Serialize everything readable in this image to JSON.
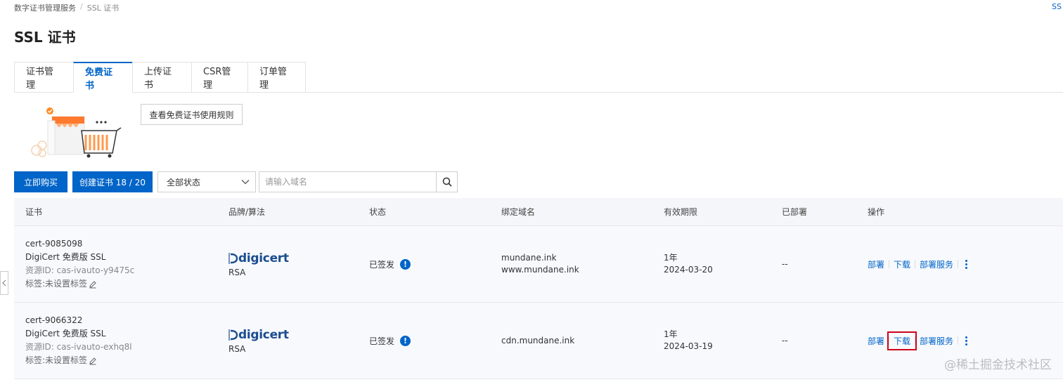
{
  "breadcrumb": {
    "root": "数字证书管理服务",
    "separator": "/",
    "current": "SSL 证书"
  },
  "corner_link": "SS",
  "page_title": "SSL 证书",
  "tabs": [
    {
      "label": "证书管理",
      "active": false
    },
    {
      "label": "免费证书",
      "active": true
    },
    {
      "label": "上传证书",
      "active": false
    },
    {
      "label": "CSR管理",
      "active": false
    },
    {
      "label": "订单管理",
      "active": false
    }
  ],
  "rules_button": "查看免费证书使用规则",
  "toolbar": {
    "buy_label": "立即购买",
    "create_label": "创建证书 18 / 20",
    "status_select": "全部状态",
    "search_placeholder": "请输入域名"
  },
  "table": {
    "headers": [
      "证书",
      "品牌/算法",
      "状态",
      "绑定域名",
      "有效期限",
      "已部署",
      "操作"
    ],
    "rows": [
      {
        "cert_id": "cert-9085098",
        "cert_type": "DigiCert 免费版 SSL",
        "resource_id": "资源ID: cas-ivauto-y9475c",
        "tag": "标签:未设置标签",
        "brand": "digicert",
        "algorithm": "RSA",
        "status": "已签发",
        "domain_1": "mundane.ink",
        "domain_2": "www.mundane.ink",
        "validity_period": "1年",
        "validity_date": "2024-03-20",
        "deployed": "--",
        "op_deploy": "部署",
        "op_download": "下载",
        "op_service": "部署服务"
      },
      {
        "cert_id": "cert-9066322",
        "cert_type": "DigiCert 免费版 SSL",
        "resource_id": "资源ID: cas-ivauto-exhq8l",
        "tag": "标签:未设置标签",
        "brand": "digicert",
        "algorithm": "RSA",
        "status": "已签发",
        "domain_1": "cdn.mundane.ink",
        "domain_2": "",
        "validity_period": "1年",
        "validity_date": "2024-03-19",
        "deployed": "--",
        "op_deploy": "部署",
        "op_download": "下载",
        "op_service": "部署服务"
      }
    ]
  },
  "watermark": "@稀土掘金技术社区",
  "colors": {
    "accent": "#0064c8",
    "highlight": "#d0021b",
    "header_bg": "#f4f6f9"
  }
}
